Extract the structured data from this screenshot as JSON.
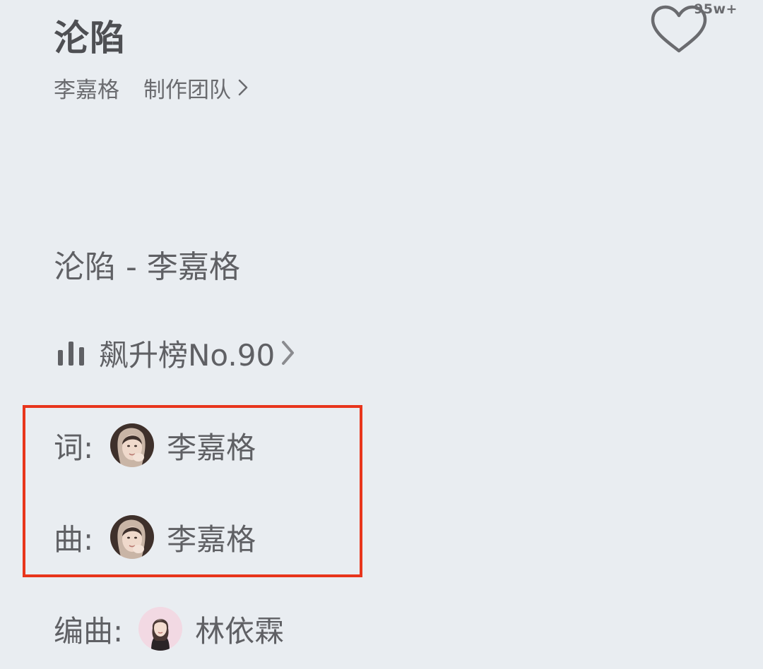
{
  "header": {
    "title": "沦陷",
    "like_count": "95w+",
    "artist": "李嘉格",
    "team_label": "制作团队"
  },
  "info": {
    "song_artist_line": "沦陷 - 李嘉格",
    "chart_label": "飙升榜No.90"
  },
  "credits": {
    "lyricist": {
      "label": "词:",
      "name": "李嘉格"
    },
    "composer": {
      "label": "曲:",
      "name": "李嘉格"
    },
    "arranger": {
      "label": "编曲:",
      "name": "林依霖"
    }
  },
  "icons": {
    "like": "heart-outline-icon",
    "team_chevron": "chevron-right-icon",
    "chart": "bar-chart-icon",
    "chart_chevron": "chevron-right-icon",
    "avatars": [
      "avatar-photo",
      "avatar-photo",
      "avatar-photo"
    ]
  },
  "colors": {
    "background": "#e9edf1",
    "text": "#5f6064",
    "highlight_border": "#e8351c"
  }
}
